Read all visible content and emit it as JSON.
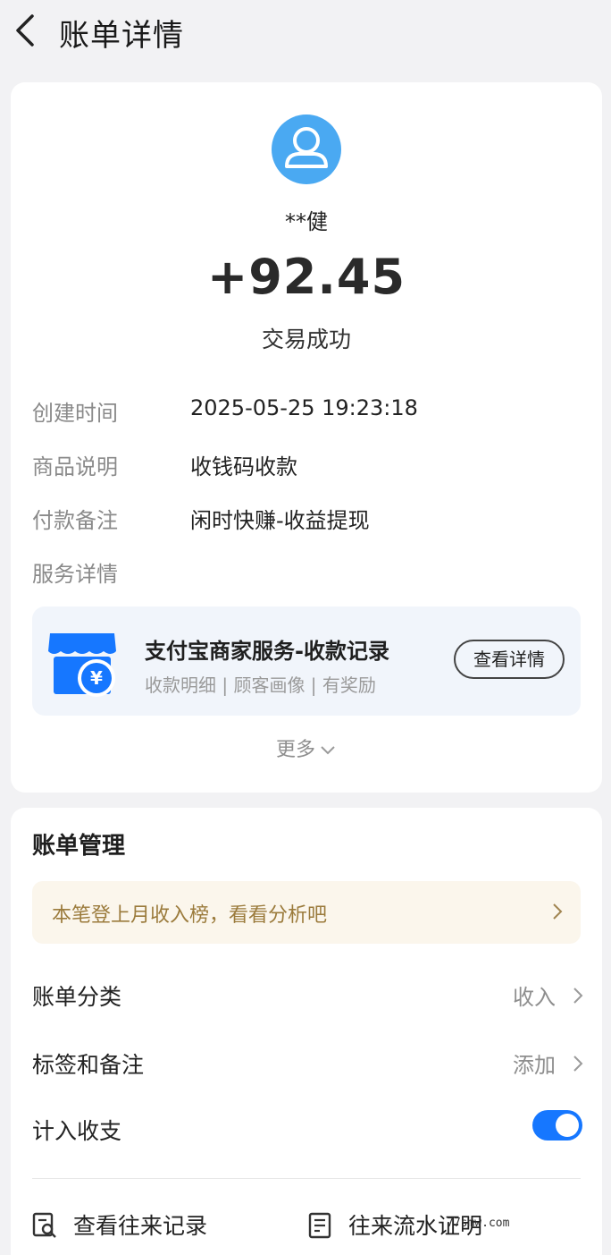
{
  "header": {
    "title": "账单详情"
  },
  "transaction": {
    "payer": "**健",
    "amount": "+92.45",
    "status": "交易成功"
  },
  "details": [
    {
      "label": "创建时间",
      "value": "2025-05-25 19:23:18"
    },
    {
      "label": "商品说明",
      "value": "收钱码收款"
    },
    {
      "label": "付款备注",
      "value": "闲时快赚-收益提现"
    },
    {
      "label": "服务详情",
      "value": ""
    }
  ],
  "service": {
    "title": "支付宝商家服务-收款记录",
    "subtitle": "收款明细 | 顾客画像 | 有奖励",
    "button": "查看详情"
  },
  "more": "更多",
  "management": {
    "title": "账单管理",
    "banner": "本笔登上月收入榜，看看分析吧",
    "rows": [
      {
        "label": "账单分类",
        "value": "收入"
      },
      {
        "label": "标签和备注",
        "value": "添加"
      },
      {
        "label": "计入收支",
        "value": ""
      }
    ],
    "include_in_stats": true,
    "links": [
      {
        "label": "查看往来记录",
        "icon": "search-document-icon"
      },
      {
        "label": "往来流水证明",
        "icon": "certificate-icon"
      }
    ]
  },
  "watermark": "77smw.com",
  "colors": {
    "accent": "#1677ff",
    "avatar": "#4aa9f2",
    "banner_text": "#9b7b3c"
  }
}
